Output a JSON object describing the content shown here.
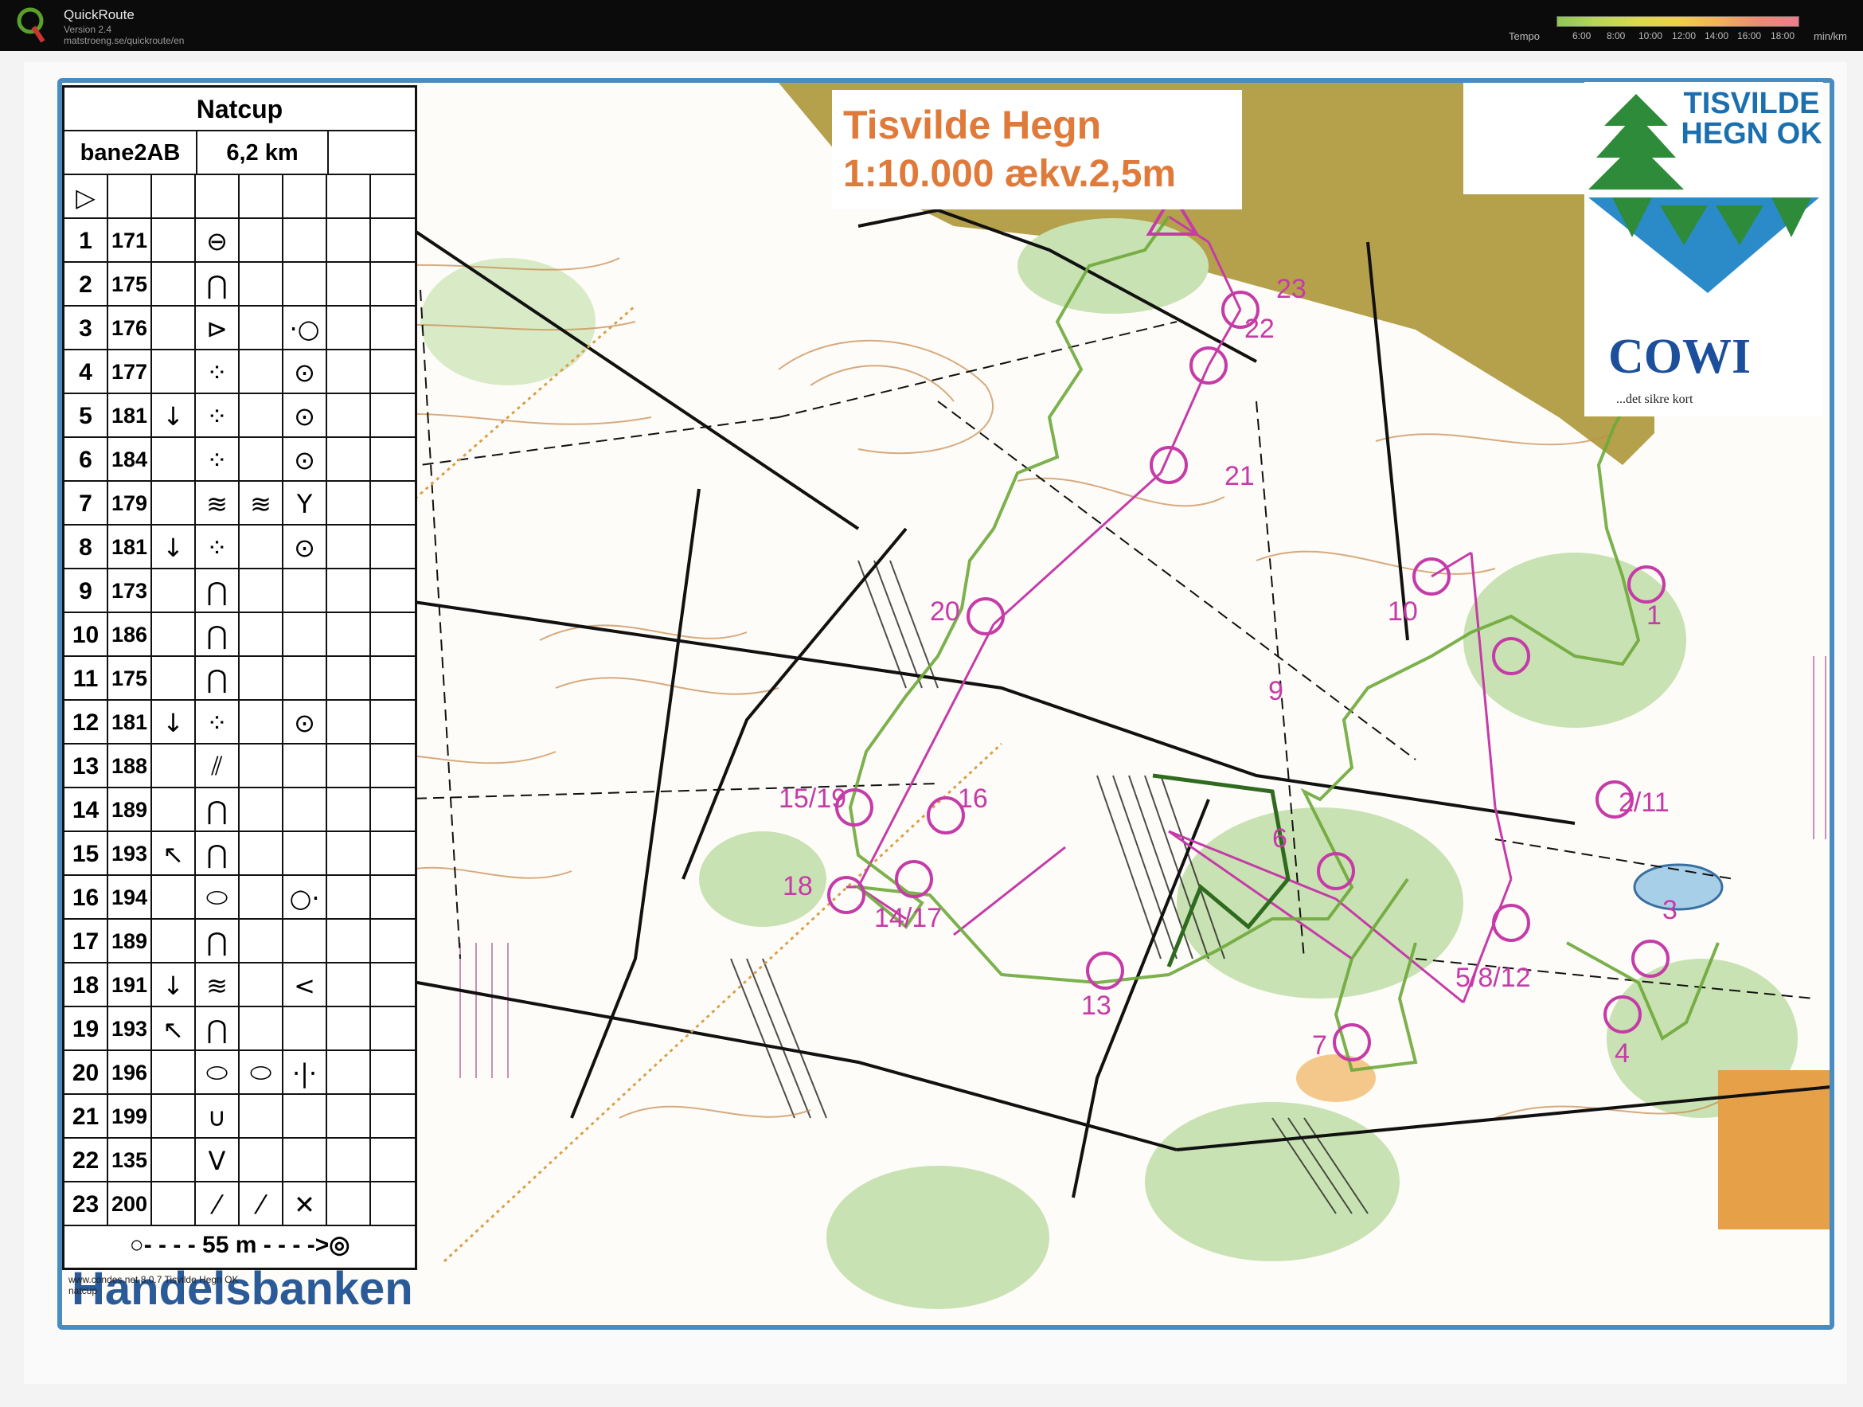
{
  "app": {
    "name": "QuickRoute",
    "version": "Version 2.4",
    "url": "matstroeng.se/quickroute/en",
    "tempo_label": "Tempo",
    "tempo_ticks": [
      "6:00",
      "8:00",
      "10:00",
      "12:00",
      "14:00",
      "16:00",
      "18:00"
    ],
    "tempo_unit": "min/km"
  },
  "legend": {
    "title": "Natcup",
    "course": "bane2AB",
    "length": "6,2 km",
    "start_symbol": "▷",
    "rows": [
      {
        "n": "1",
        "code": "171",
        "c": "",
        "d": "⊖",
        "e": "",
        "f": ""
      },
      {
        "n": "2",
        "code": "175",
        "c": "",
        "d": "⋂",
        "e": "",
        "f": ""
      },
      {
        "n": "3",
        "code": "176",
        "c": "",
        "d": "⊳",
        "e": "",
        "f": "·○"
      },
      {
        "n": "4",
        "code": "177",
        "c": "",
        "d": "⁘",
        "e": "",
        "f": "⊙"
      },
      {
        "n": "5",
        "code": "181",
        "c": "↓",
        "d": "⁘",
        "e": "",
        "f": "⊙"
      },
      {
        "n": "6",
        "code": "184",
        "c": "",
        "d": "⁘",
        "e": "",
        "f": "⊙"
      },
      {
        "n": "7",
        "code": "179",
        "c": "",
        "d": "≋",
        "e": "≋",
        "f": "Y"
      },
      {
        "n": "8",
        "code": "181",
        "c": "↓",
        "d": "⁘",
        "e": "",
        "f": "⊙"
      },
      {
        "n": "9",
        "code": "173",
        "c": "",
        "d": "⋂",
        "e": "",
        "f": ""
      },
      {
        "n": "10",
        "code": "186",
        "c": "",
        "d": "⋂",
        "e": "",
        "f": ""
      },
      {
        "n": "11",
        "code": "175",
        "c": "",
        "d": "⋂",
        "e": "",
        "f": ""
      },
      {
        "n": "12",
        "code": "181",
        "c": "↓",
        "d": "⁘",
        "e": "",
        "f": "⊙"
      },
      {
        "n": "13",
        "code": "188",
        "c": "",
        "d": "⫽",
        "e": "",
        "f": ""
      },
      {
        "n": "14",
        "code": "189",
        "c": "",
        "d": "⋂",
        "e": "",
        "f": ""
      },
      {
        "n": "15",
        "code": "193",
        "c": "↖",
        "d": "⋂",
        "e": "",
        "f": ""
      },
      {
        "n": "16",
        "code": "194",
        "c": "",
        "d": "⬭",
        "e": "",
        "f": "○·"
      },
      {
        "n": "17",
        "code": "189",
        "c": "",
        "d": "⋂",
        "e": "",
        "f": ""
      },
      {
        "n": "18",
        "code": "191",
        "c": "↓",
        "d": "≋",
        "e": "",
        "f": "<"
      },
      {
        "n": "19",
        "code": "193",
        "c": "↖",
        "d": "⋂",
        "e": "",
        "f": ""
      },
      {
        "n": "20",
        "code": "196",
        "c": "",
        "d": "⬭",
        "e": "⬭",
        "f": "⋅|⋅"
      },
      {
        "n": "21",
        "code": "199",
        "c": "",
        "d": "∪",
        "e": "",
        "f": ""
      },
      {
        "n": "22",
        "code": "135",
        "c": "",
        "d": "V",
        "e": "",
        "f": ""
      },
      {
        "n": "23",
        "code": "200",
        "c": "",
        "d": "⁄",
        "e": "⁄",
        "f": "✕"
      }
    ],
    "finish": "○- - - - 55 m - - - ->◎"
  },
  "map_title": {
    "line1": "Tisvilde Hegn",
    "line2": "1:10.000 ækv.2,5m"
  },
  "club": {
    "name_line1": "TISVILDE",
    "name_line2": "HEGN OK",
    "sponsor_logo": "COWI",
    "sponsor_tag": "...det sikre kort"
  },
  "bottom_sponsor": "Handelsbanken",
  "small_print": {
    "line1": "www.condes.net 8.0.7 Tisvilde Hegn OK",
    "line2": "natcup"
  },
  "controls": [
    {
      "label": "1"
    },
    {
      "label": "2/11"
    },
    {
      "label": "3"
    },
    {
      "label": "4"
    },
    {
      "label": "5/8/12"
    },
    {
      "label": "6"
    },
    {
      "label": "7"
    },
    {
      "label": "9"
    },
    {
      "label": "10"
    },
    {
      "label": "13"
    },
    {
      "label": "14/17"
    },
    {
      "label": "15/19"
    },
    {
      "label": "16"
    },
    {
      "label": "18"
    },
    {
      "label": "20"
    },
    {
      "label": "21"
    },
    {
      "label": "22"
    },
    {
      "label": "23"
    }
  ],
  "colors": {
    "course": "#c53ba8",
    "route": "#6ea83a",
    "frame": "#4a8cc0",
    "contour": "#c8874a",
    "vegetation": "#c9e2b3",
    "urban": "#a68a3a"
  },
  "icons": [
    "quickroute-logo",
    "tree-logo-icon"
  ]
}
